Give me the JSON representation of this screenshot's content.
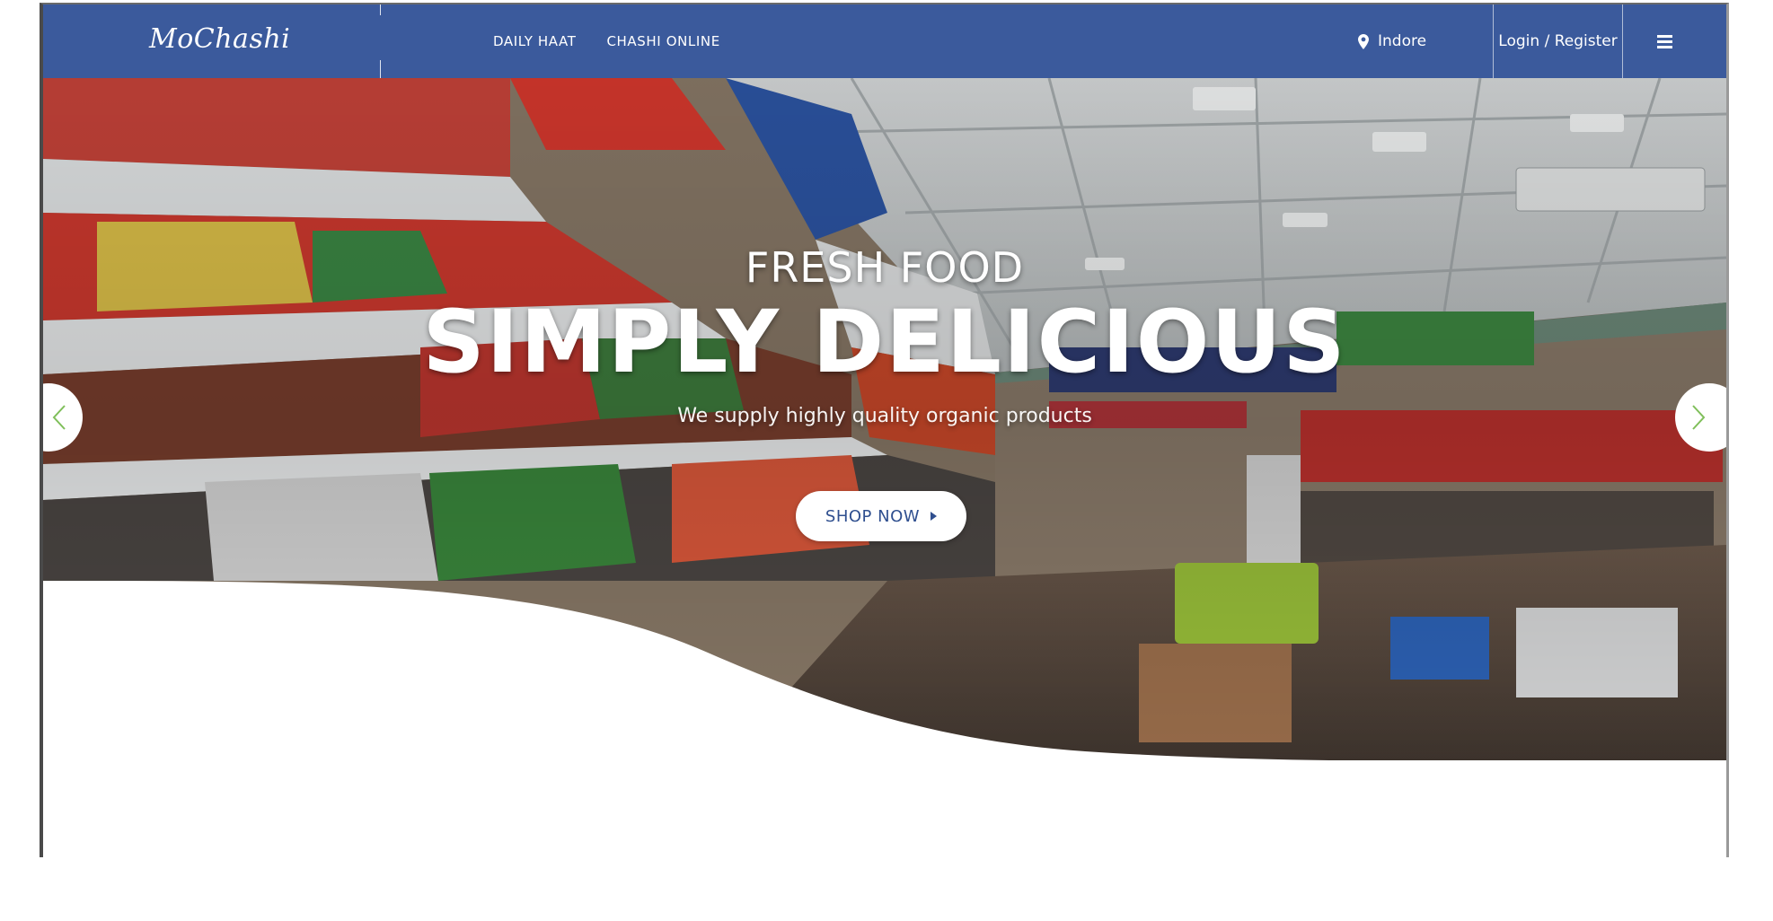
{
  "brand": {
    "logo_text": "MoChashi",
    "nav_color": "#3b5a9c"
  },
  "nav": {
    "links": [
      "DAILY HAAT",
      "CHASHI ONLINE"
    ],
    "location": "Indore",
    "login_label": "Login / Register",
    "menu_icon": "hamburger-icon"
  },
  "hero": {
    "kicker": "FRESH FOOD",
    "title": "SIMPLY DELICIOUS",
    "subtitle": "We supply highly quality organic products",
    "cta_label": "SHOP NOW",
    "prev_icon": "chevron-left-icon",
    "next_icon": "chevron-right-icon",
    "accent_arrow_color": "#7fbf5a",
    "background_description_icon": "grocery-store-image"
  }
}
